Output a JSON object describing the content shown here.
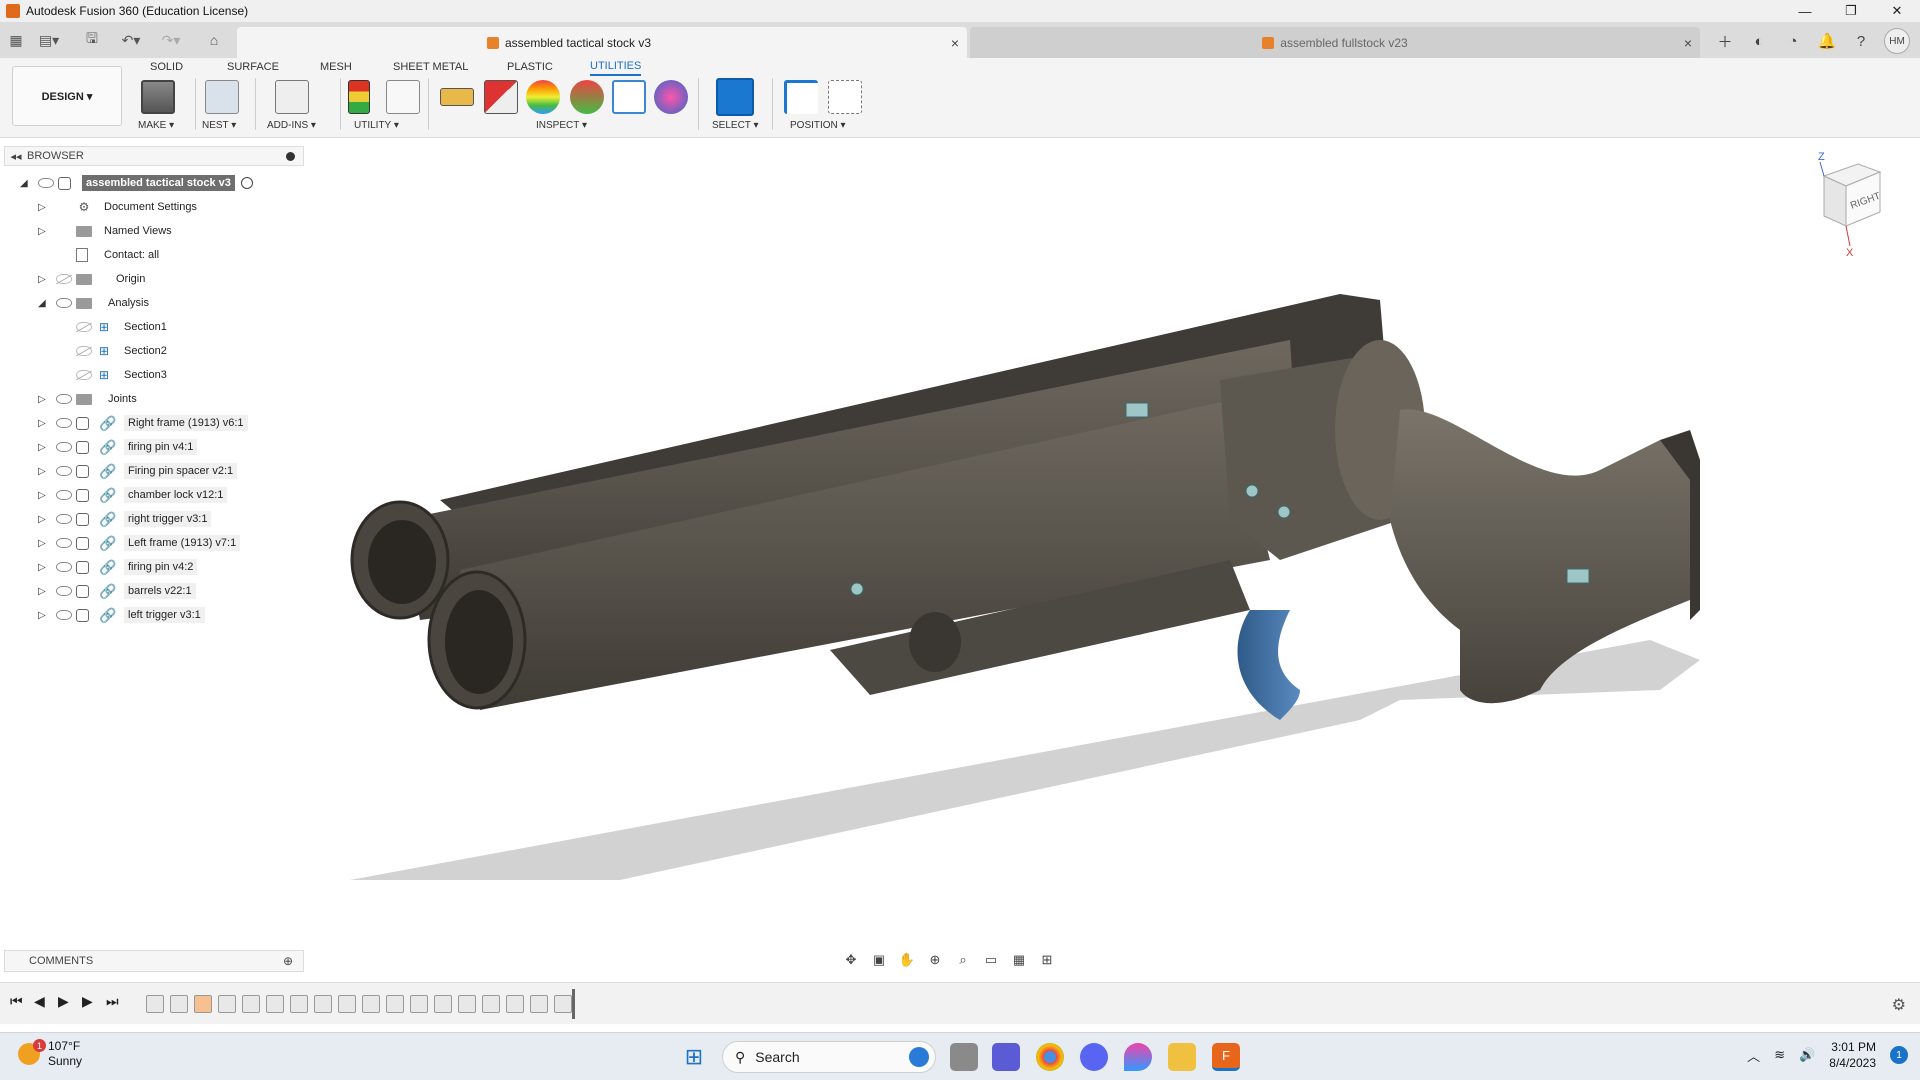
{
  "window": {
    "title": "Autodesk Fusion 360 (Education License)",
    "controls": [
      "—",
      "❐",
      "✕"
    ]
  },
  "tabs": {
    "active": "assembled tactical stock v3",
    "inactive": "assembled fullstock v23",
    "close": "×"
  },
  "user": {
    "initials": "HM"
  },
  "workspace_tabs": [
    "SOLID",
    "SURFACE",
    "MESH",
    "SHEET METAL",
    "PLASTIC",
    "UTILITIES"
  ],
  "design_button": "DESIGN ▾",
  "groups": {
    "make": "MAKE ▾",
    "nest": "NEST ▾",
    "addins": "ADD-INS ▾",
    "utility": "UTILITY ▾",
    "inspect": "INSPECT ▾",
    "select": "SELECT ▾",
    "position": "POSITION ▾"
  },
  "browser": {
    "title": "BROWSER",
    "root": "assembled tactical stock v3",
    "items": [
      {
        "label": "Document Settings"
      },
      {
        "label": "Named Views"
      },
      {
        "label": "Contact: all"
      },
      {
        "label": "Origin"
      },
      {
        "label": "Analysis"
      },
      {
        "label": "Section1"
      },
      {
        "label": "Section2"
      },
      {
        "label": "Section3"
      },
      {
        "label": "Joints"
      },
      {
        "label": "Right frame (1913) v6:1"
      },
      {
        "label": "firing pin v4:1"
      },
      {
        "label": "Firing pin spacer v2:1"
      },
      {
        "label": "chamber lock v12:1"
      },
      {
        "label": "right trigger v3:1"
      },
      {
        "label": "Left frame (1913) v7:1"
      },
      {
        "label": "firing pin v4:2"
      },
      {
        "label": "barrels v22:1"
      },
      {
        "label": "left trigger v3:1"
      }
    ]
  },
  "comments": {
    "title": "COMMENTS"
  },
  "viewcube": {
    "face": "RIGHT",
    "axis_z": "Z",
    "axis_x": "X"
  },
  "taskbar": {
    "temperature": "107°F",
    "condition": "Sunny",
    "weather_badge": "1",
    "search_label": "Search",
    "time": "3:01 PM",
    "date": "8/4/2023",
    "notifications": "1"
  },
  "colors": {
    "body": "#5a554d",
    "trigger": "#3e6c9e",
    "accent": "#1a73c8",
    "shadow": "#cfcfcf"
  }
}
